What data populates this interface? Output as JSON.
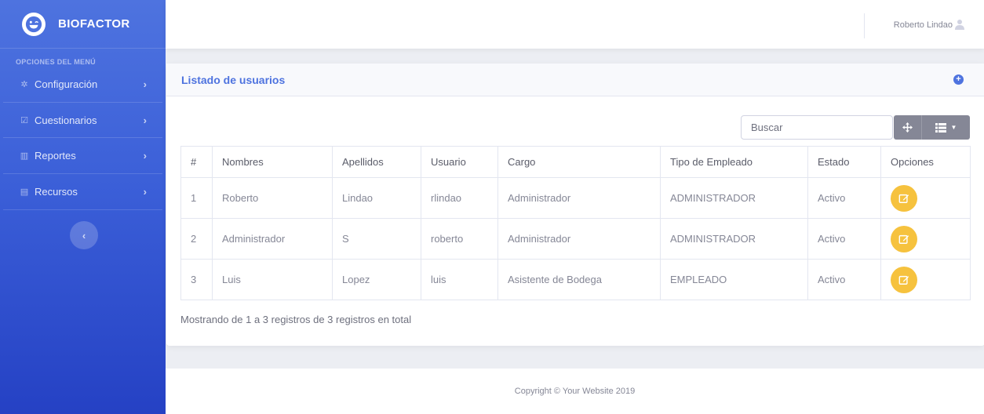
{
  "sidebar": {
    "brand": "BIOFACTOR",
    "menu_heading": "OPCIONES DEL MENÚ",
    "items": [
      {
        "label": "Configuración",
        "icon": "gear-icon"
      },
      {
        "label": "Cuestionarios",
        "icon": "checkbox-icon"
      },
      {
        "label": "Reportes",
        "icon": "bar-chart-icon"
      },
      {
        "label": "Recursos",
        "icon": "document-icon"
      }
    ]
  },
  "topbar": {
    "user_name": "Roberto Lindao"
  },
  "card": {
    "title": "Listado de usuarios",
    "search_placeholder": "Buscar",
    "columns": [
      "#",
      "Nombres",
      "Apellidos",
      "Usuario",
      "Cargo",
      "Tipo de Empleado",
      "Estado",
      "Opciones"
    ],
    "rows": [
      {
        "num": "1",
        "nombres": "Roberto",
        "apellidos": "Lindao",
        "usuario": "rlindao",
        "cargo": "Administrador",
        "tipo": "ADMINISTRADOR",
        "estado": "Activo"
      },
      {
        "num": "2",
        "nombres": "Administrador",
        "apellidos": "S",
        "usuario": "roberto",
        "cargo": "Administrador",
        "tipo": "ADMINISTRADOR",
        "estado": "Activo"
      },
      {
        "num": "3",
        "nombres": "Luis",
        "apellidos": "Lopez",
        "usuario": "luis",
        "cargo": "Asistente de Bodega",
        "tipo": "EMPLEADO",
        "estado": "Activo"
      }
    ],
    "summary": "Mostrando de 1 a 3 registros de 3 registros en total"
  },
  "footer": {
    "copyright": "Copyright © Your Website 2019"
  },
  "colors": {
    "primary": "#4e73df",
    "warning": "#f6c23e",
    "secondary": "#858796"
  }
}
